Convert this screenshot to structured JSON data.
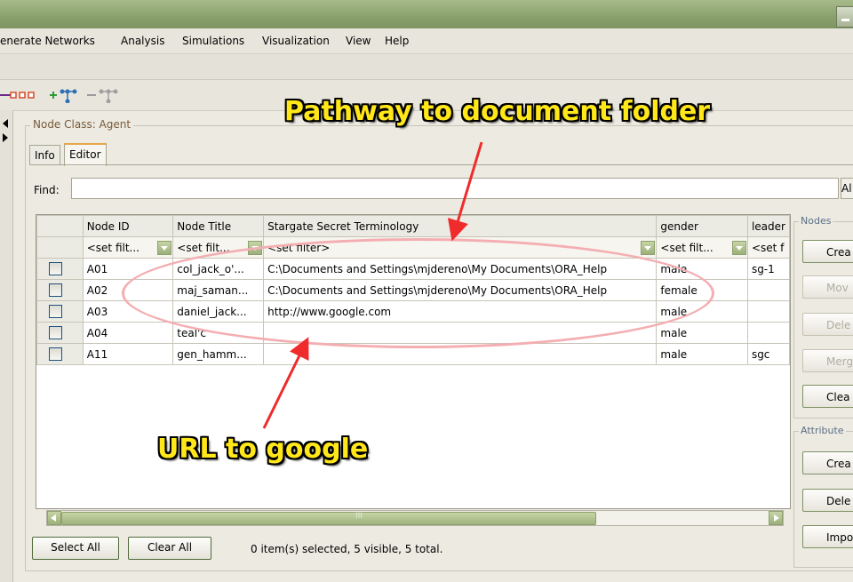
{
  "menu": [
    "enerate Networks",
    "Analysis",
    "Simulations",
    "Visualization",
    "View",
    "Help"
  ],
  "panel_title": "Node Class: Agent",
  "tabs": [
    {
      "label": "Info"
    },
    {
      "label": "Editor"
    }
  ],
  "find": {
    "label": "Find:",
    "value": "",
    "right_clip": "Al"
  },
  "table": {
    "columns": [
      "Node ID",
      "Node Title",
      "Stargate Secret Terminology",
      "gender",
      "leader"
    ],
    "filters": [
      "<set filt...",
      "<set filt...",
      "<set filter>",
      "<set filt...",
      "<set f"
    ],
    "rows": [
      {
        "id": "A01",
        "title": "col_jack_o'...",
        "terminology": "C:\\Documents and Settings\\mjdereno\\My Documents\\ORA_Help",
        "gender": "male",
        "leader": "sg-1"
      },
      {
        "id": "A02",
        "title": "maj_saman...",
        "terminology": "C:\\Documents and Settings\\mjdereno\\My Documents\\ORA_Help",
        "gender": "female",
        "leader": ""
      },
      {
        "id": "A03",
        "title": "daniel_jack...",
        "terminology": "http://www.google.com",
        "gender": "male",
        "leader": ""
      },
      {
        "id": "A04",
        "title": "teal'c",
        "terminology": "",
        "gender": "male",
        "leader": ""
      },
      {
        "id": "A11",
        "title": "gen_hamm...",
        "terminology": "",
        "gender": "male",
        "leader": "sgc"
      }
    ]
  },
  "scroll_grip": "III",
  "footer": {
    "select_all": "Select All",
    "clear_all": "Clear All",
    "status": "0 item(s) selected, 5 visible, 5 total."
  },
  "nodes_group": {
    "title": "Nodes",
    "buttons": [
      "Crea",
      "Mov",
      "Dele",
      "Merg",
      "Clea"
    ]
  },
  "attributes_group": {
    "title": "Attribute",
    "buttons": [
      "Crea",
      "Dele",
      "Impo"
    ]
  },
  "annotations": {
    "top": "Pathway to document folder",
    "bottom": "URL to google"
  },
  "colors": {
    "annotation_text": "#ffe71a",
    "arrow": "#ef2b2b",
    "ellipse": "#f4aeb2",
    "titlebar": "#8aa06c"
  }
}
